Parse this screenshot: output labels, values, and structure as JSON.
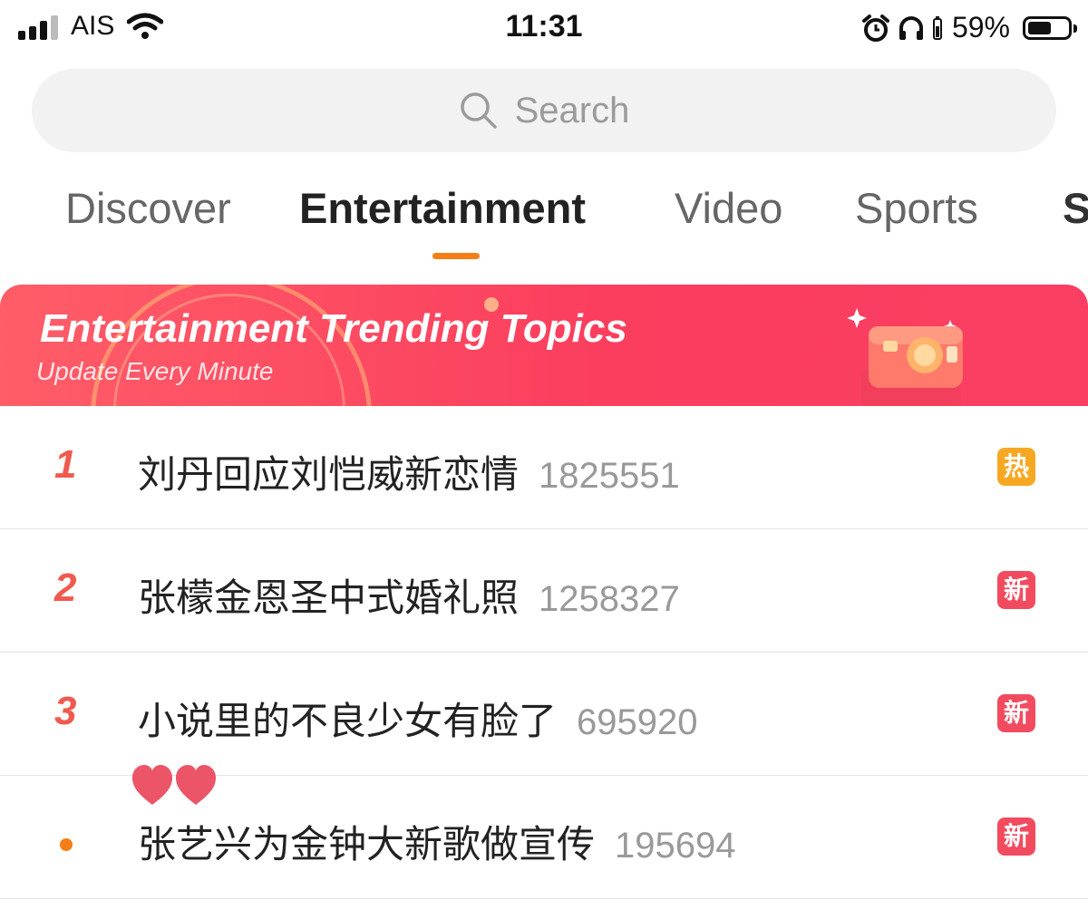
{
  "status_bar": {
    "carrier": "AIS",
    "time": "11:31",
    "battery_percent": "59%",
    "battery_level": 0.59,
    "icons": [
      "signal-icon",
      "wifi-icon",
      "alarm-icon",
      "headphones-icon",
      "battery-icon"
    ]
  },
  "search": {
    "placeholder": "Search",
    "icon": "search-icon"
  },
  "tabs": [
    {
      "label": "Discover",
      "active": false
    },
    {
      "label": "Entertainment",
      "active": true
    },
    {
      "label": "Video",
      "active": false
    },
    {
      "label": "Sports",
      "active": false
    },
    {
      "label": "St",
      "active": false
    }
  ],
  "banner": {
    "title": "Entertainment Trending Topics",
    "subtitle": "Update Every Minute",
    "icon": "camera-illustration-icon"
  },
  "topics": [
    {
      "rank": "1",
      "title": "刘丹回应刘恺威新恋情",
      "count": "1825551",
      "badge": "热",
      "badge_color": "#f7a823"
    },
    {
      "rank": "2",
      "title": "张檬金恩圣中式婚礼照",
      "count": "1258327",
      "badge": "新",
      "badge_color": "#f24b5f"
    },
    {
      "rank": "3",
      "title": "小说里的不良少女有脸了",
      "count": "695920",
      "badge": "新",
      "badge_color": "#f24b5f"
    },
    {
      "rank": "",
      "title": "张艺兴为金钟大新歌做宣传",
      "count": "195694",
      "badge": "新",
      "badge_color": "#f24b5f"
    }
  ],
  "colors": {
    "accent": "#f57f17",
    "banner": "#fb3e5e",
    "rank": "#f05a4e",
    "hot_badge": "#f7a823",
    "new_badge": "#f24b5f"
  }
}
